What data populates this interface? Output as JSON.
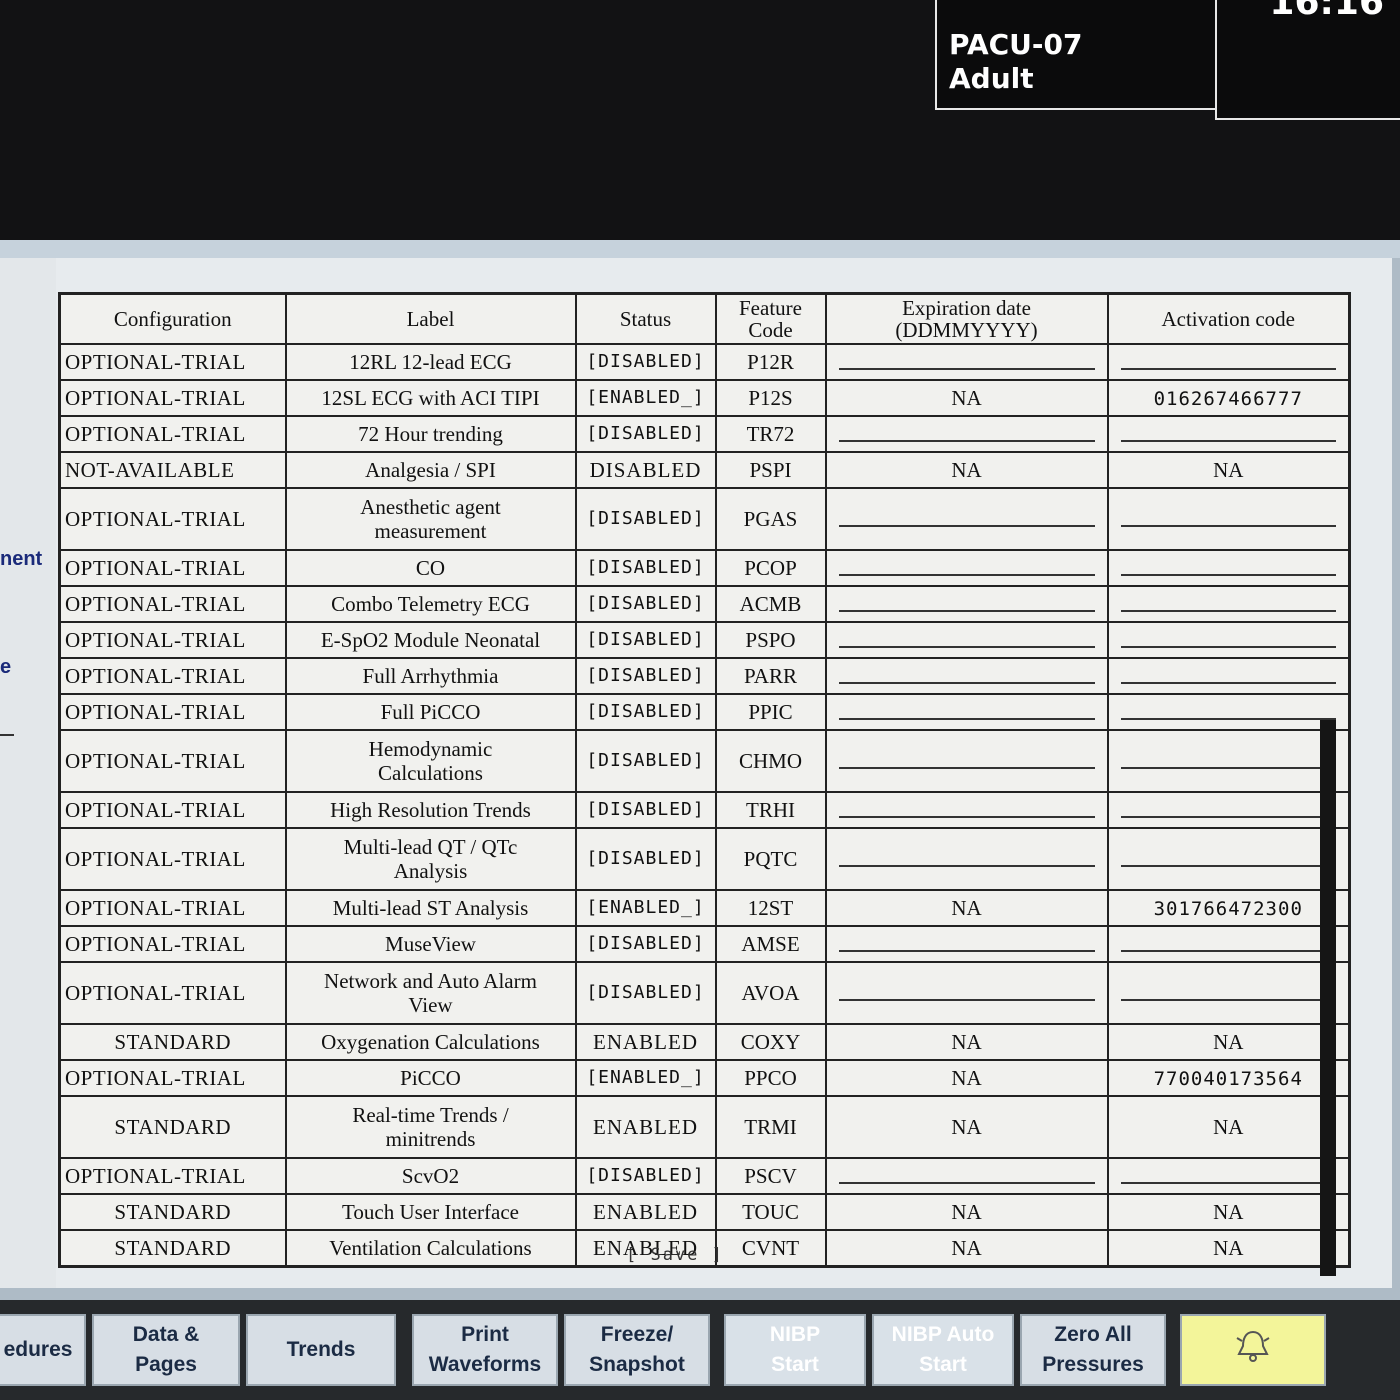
{
  "patient": {
    "location": "PACU-07",
    "type": "Adult"
  },
  "clock": {
    "time": "16:16"
  },
  "left_fragments": [
    "nent",
    "e"
  ],
  "table": {
    "headers": {
      "configuration": "Configuration",
      "label": "Label",
      "status": "Status",
      "feature_code": "Feature\nCode",
      "expiration": "Expiration date\n(DDMMYYYY)",
      "activation": "Activation code"
    },
    "rows": [
      {
        "cfg": "OPTIONAL-TRIAL",
        "label": "12RL 12-lead ECG",
        "status": "[DISABLED]",
        "code": "P12R",
        "exp": "",
        "act": ""
      },
      {
        "cfg": "OPTIONAL-TRIAL",
        "label": "12SL ECG with ACI TIPI",
        "status": "[ENABLED_]",
        "code": "P12S",
        "exp": "NA",
        "act": "016267466777"
      },
      {
        "cfg": "OPTIONAL-TRIAL",
        "label": "72 Hour trending",
        "status": "[DISABLED]",
        "code": "TR72",
        "exp": "",
        "act": ""
      },
      {
        "cfg": "NOT-AVAILABLE",
        "label": "Analgesia / SPI",
        "status": "DISABLED",
        "code": "PSPI",
        "exp": "NA",
        "act": "NA"
      },
      {
        "cfg": "OPTIONAL-TRIAL",
        "label": "Anesthetic agent\nmeasurement",
        "status": "[DISABLED]",
        "code": "PGAS",
        "exp": "",
        "act": ""
      },
      {
        "cfg": "OPTIONAL-TRIAL",
        "label": "CO",
        "status": "[DISABLED]",
        "code": "PCOP",
        "exp": "",
        "act": ""
      },
      {
        "cfg": "OPTIONAL-TRIAL",
        "label": "Combo Telemetry ECG",
        "status": "[DISABLED]",
        "code": "ACMB",
        "exp": "",
        "act": ""
      },
      {
        "cfg": "OPTIONAL-TRIAL",
        "label": "E-SpO2 Module Neonatal",
        "status": "[DISABLED]",
        "code": "PSPO",
        "exp": "",
        "act": ""
      },
      {
        "cfg": "OPTIONAL-TRIAL",
        "label": "Full Arrhythmia",
        "status": "[DISABLED]",
        "code": "PARR",
        "exp": "",
        "act": ""
      },
      {
        "cfg": "OPTIONAL-TRIAL",
        "label": "Full PiCCO",
        "status": "[DISABLED]",
        "code": "PPIC",
        "exp": "",
        "act": ""
      },
      {
        "cfg": "OPTIONAL-TRIAL",
        "label": "Hemodynamic\nCalculations",
        "status": "[DISABLED]",
        "code": "CHMO",
        "exp": "",
        "act": ""
      },
      {
        "cfg": "OPTIONAL-TRIAL",
        "label": "High Resolution Trends",
        "status": "[DISABLED]",
        "code": "TRHI",
        "exp": "",
        "act": ""
      },
      {
        "cfg": "OPTIONAL-TRIAL",
        "label": "Multi-lead QT / QTc\nAnalysis",
        "status": "[DISABLED]",
        "code": "PQTC",
        "exp": "",
        "act": ""
      },
      {
        "cfg": "OPTIONAL-TRIAL",
        "label": "Multi-lead ST Analysis",
        "status": "[ENABLED_]",
        "code": "12ST",
        "exp": "NA",
        "act": "301766472300"
      },
      {
        "cfg": "OPTIONAL-TRIAL",
        "label": "MuseView",
        "status": "[DISABLED]",
        "code": "AMSE",
        "exp": "",
        "act": ""
      },
      {
        "cfg": "OPTIONAL-TRIAL",
        "label": "Network and Auto Alarm\nView",
        "status": "[DISABLED]",
        "code": "AVOA",
        "exp": "",
        "act": ""
      },
      {
        "cfg": "STANDARD",
        "label": "Oxygenation Calculations",
        "status": "ENABLED",
        "code": "COXY",
        "exp": "NA",
        "act": "NA"
      },
      {
        "cfg": "OPTIONAL-TRIAL",
        "label": "PiCCO",
        "status": "[ENABLED_]",
        "code": "PPCO",
        "exp": "NA",
        "act": "770040173564"
      },
      {
        "cfg": "STANDARD",
        "label": "Real-time Trends /\nminitrends",
        "status": "ENABLED",
        "code": "TRMI",
        "exp": "NA",
        "act": "NA"
      },
      {
        "cfg": "OPTIONAL-TRIAL",
        "label": "ScvO2",
        "status": "[DISABLED]",
        "code": "PSCV",
        "exp": "",
        "act": ""
      },
      {
        "cfg": "STANDARD",
        "label": "Touch User Interface",
        "status": "ENABLED",
        "code": "TOUC",
        "exp": "NA",
        "act": "NA"
      },
      {
        "cfg": "STANDARD",
        "label": "Ventilation Calculations",
        "status": "ENABLED",
        "code": "CVNT",
        "exp": "NA",
        "act": "NA"
      }
    ]
  },
  "save_label": "[ Save ]",
  "softkeys": [
    {
      "label": "edures",
      "state": "enabled"
    },
    {
      "label": "Data &\nPages",
      "state": "enabled"
    },
    {
      "label": "Trends",
      "state": "enabled"
    },
    {
      "label": "Print\nWaveforms",
      "state": "enabled"
    },
    {
      "label": "Freeze/\nSnapshot",
      "state": "enabled"
    },
    {
      "label": "NIBP\nStart",
      "state": "disabled"
    },
    {
      "label": "NIBP Auto\nStart",
      "state": "disabled"
    },
    {
      "label": "Zero All\nPressures",
      "state": "enabled"
    },
    {
      "label": "",
      "icon": "alarm-bell-icon",
      "state": "enabled"
    }
  ],
  "colors": {
    "alarm_key": "#f3f59a",
    "softkey_text": "#1b2b44",
    "disabled_text": "#ffffff"
  }
}
